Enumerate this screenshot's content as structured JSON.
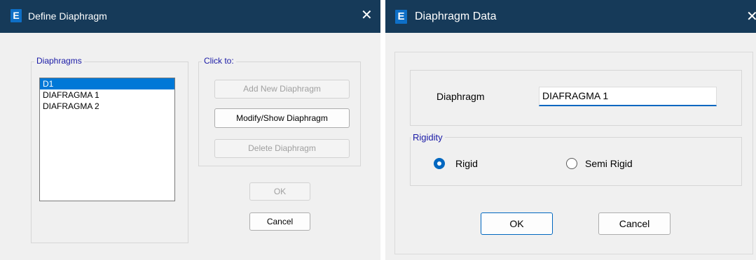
{
  "define_dialog": {
    "app_icon": "E",
    "title": "Define Diaphragm",
    "close_glyph": "✕",
    "diaphragms_group_label": "Diaphragms",
    "diaphragms": [
      {
        "name": "D1",
        "selected": true
      },
      {
        "name": "DIAFRAGMA 1",
        "selected": false
      },
      {
        "name": "DIAFRAGMA 2",
        "selected": false
      }
    ],
    "click_to_group_label": "Click to:",
    "add_button": {
      "label": "Add New Diaphragm",
      "enabled": false
    },
    "modify_button": {
      "label": "Modify/Show Diaphragm",
      "enabled": true
    },
    "delete_button": {
      "label": "Delete Diaphragm",
      "enabled": false
    },
    "ok_button": {
      "label": "OK",
      "enabled": false
    },
    "cancel_button": {
      "label": "Cancel",
      "enabled": true
    }
  },
  "data_dialog": {
    "app_icon": "E",
    "title": "Diaphragm Data",
    "close_glyph": "✕",
    "diaphragm_label": "Diaphragm",
    "diaphragm_value": "DIAFRAGMA 1",
    "rigidity_group_label": "Rigidity",
    "rigid_label": "Rigid",
    "semi_rigid_label": "Semi Rigid",
    "selected_rigidity": "Rigid",
    "ok_label": "OK",
    "cancel_label": "Cancel"
  },
  "colors": {
    "titlebar": "#163a59",
    "app_icon": "#0e6fc7",
    "accent": "#0067c0",
    "selection": "#0078d7",
    "group_label": "#1a1aa6"
  }
}
